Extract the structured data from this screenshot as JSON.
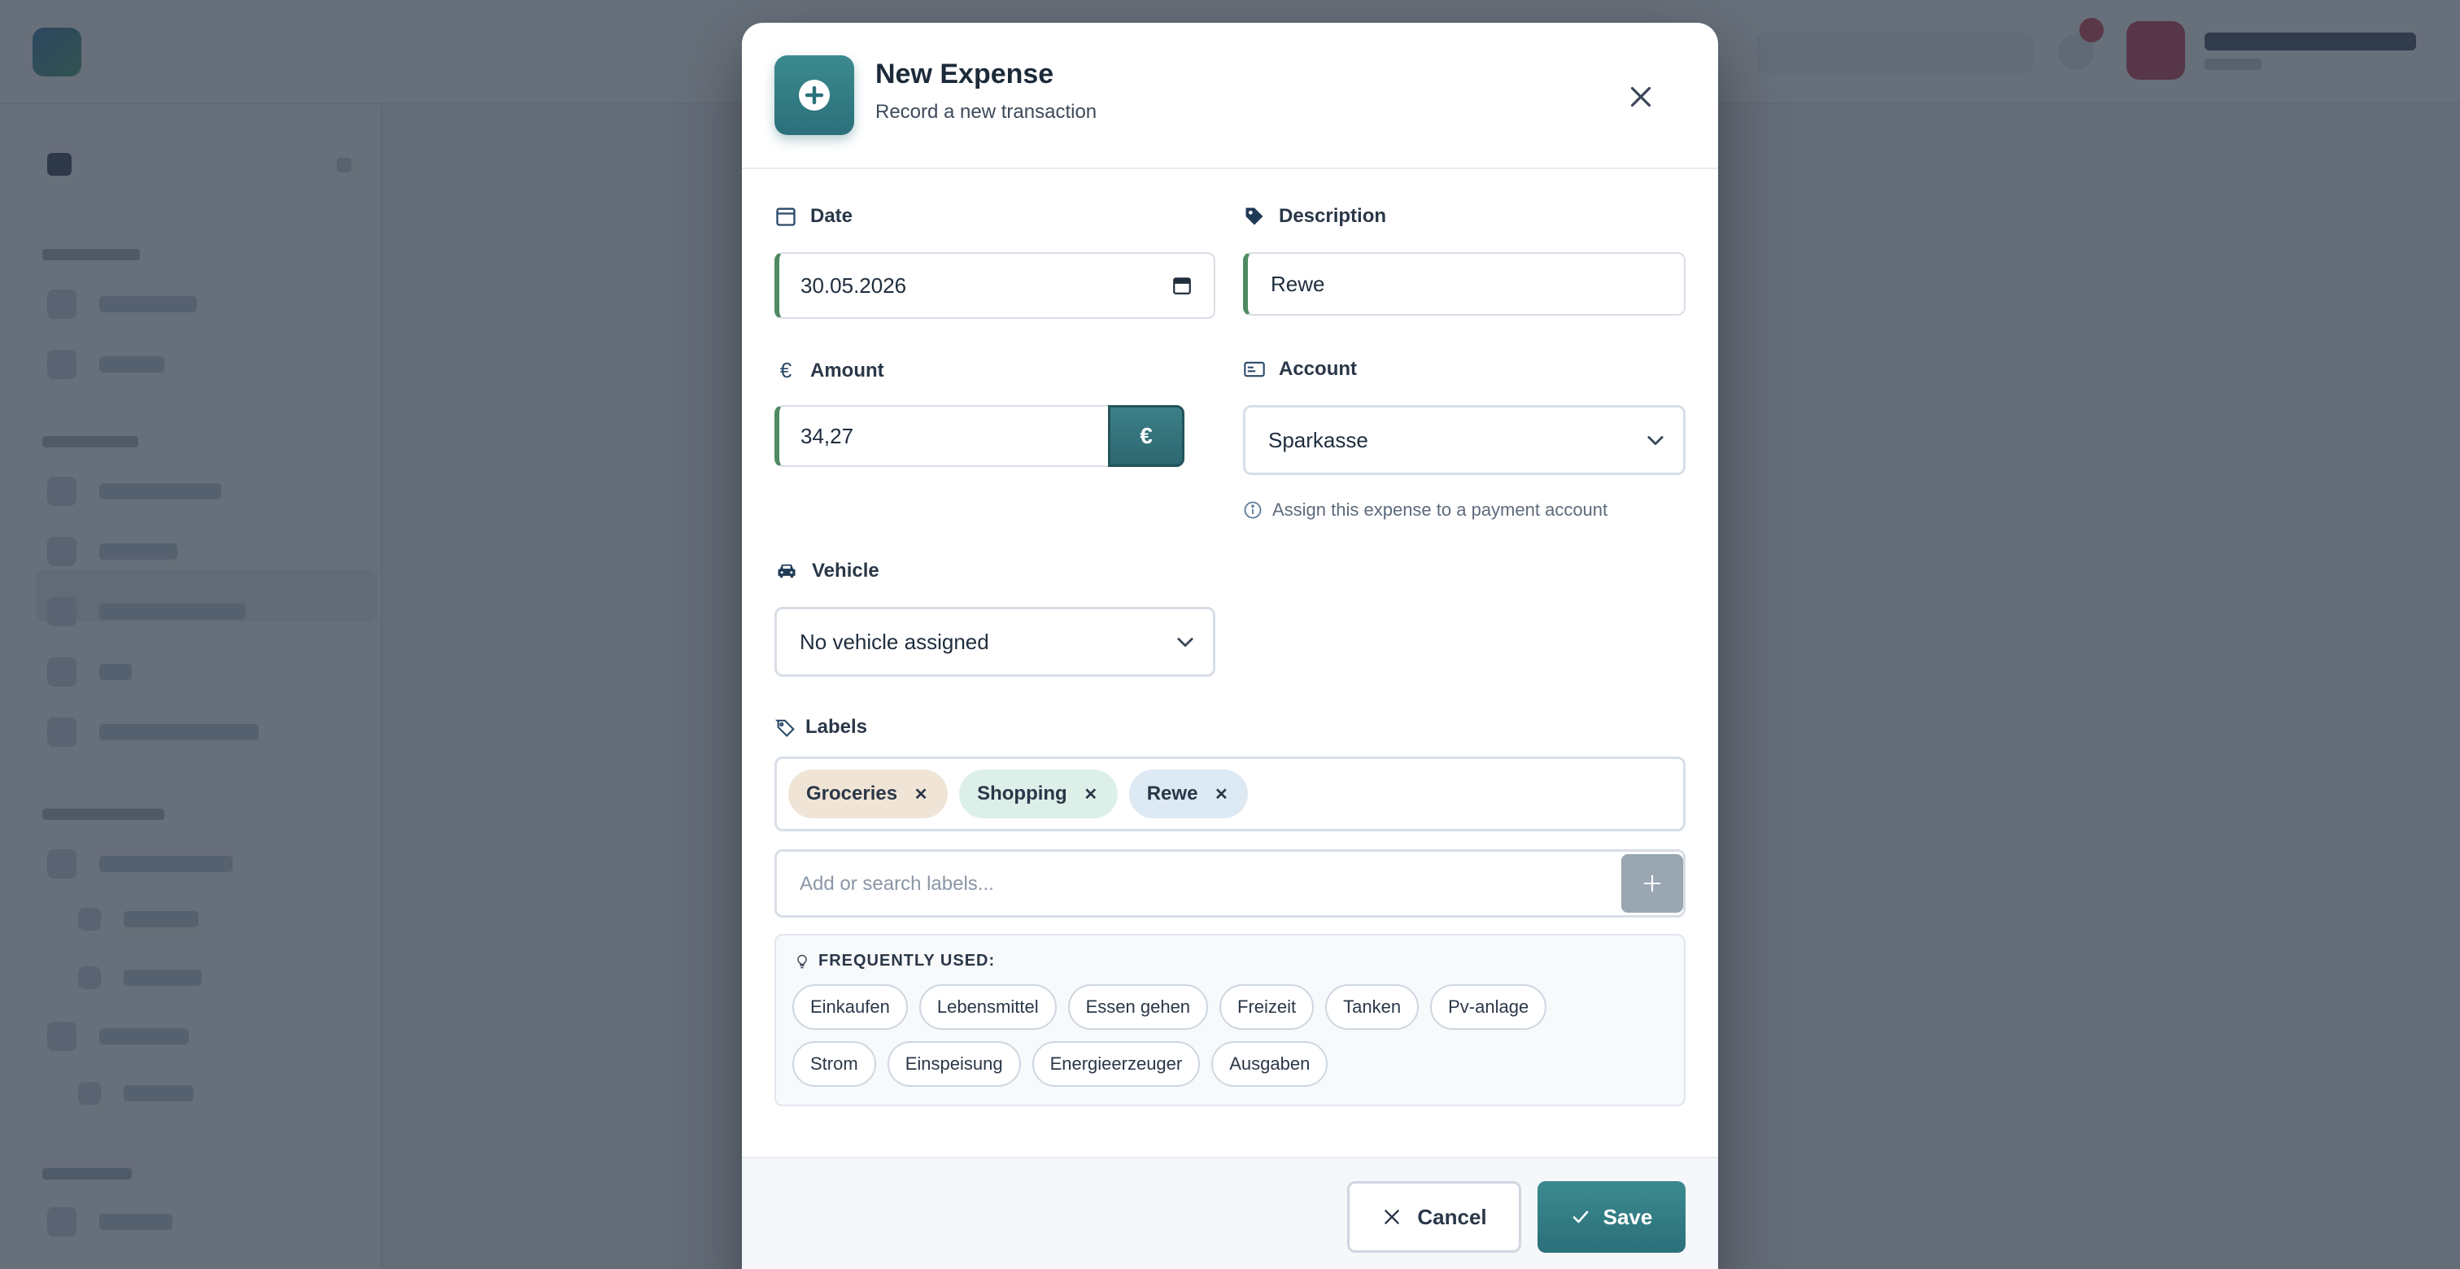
{
  "modal": {
    "title": "New Expense",
    "subtitle": "Record a new transaction"
  },
  "fields": {
    "date": {
      "label": "Date",
      "value": "30.05.2026"
    },
    "description": {
      "label": "Description",
      "value": "Rewe"
    },
    "amount": {
      "label": "Amount",
      "value": "34,27",
      "currency": "€"
    },
    "account": {
      "label": "Account",
      "value": "Sparkasse",
      "hint": "Assign this expense to a payment account"
    },
    "vehicle": {
      "label": "Vehicle",
      "value": "No vehicle assigned"
    }
  },
  "labels": {
    "label": "Labels",
    "selected": [
      {
        "text": "Groceries",
        "color": "#f0e4d6"
      },
      {
        "text": "Shopping",
        "color": "#dcefe9"
      },
      {
        "text": "Rewe",
        "color": "#dde9f3"
      }
    ],
    "search_placeholder": "Add or search labels...",
    "frequently_used_title": "FREQUENTLY USED:",
    "frequently_used": [
      "Einkaufen",
      "Lebensmittel",
      "Essen gehen",
      "Freizeit",
      "Tanken",
      "Pv-anlage",
      "Strom",
      "Einspeisung",
      "Energieerzeuger",
      "Ausgaben"
    ]
  },
  "footer": {
    "cancel_label": "Cancel",
    "save_label": "Save"
  },
  "colors": {
    "accent": "#2b6f7a",
    "field_accent": "#4f8a62",
    "overlay": "#2c3746"
  },
  "icons": {
    "header": "plus-circle-icon",
    "date": "calendar-icon",
    "description": "tag-icon",
    "amount": "euro-icon",
    "account": "credit-card-icon",
    "vehicle": "car-icon",
    "labels": "tags-icon",
    "hint": "info-icon",
    "frequent": "lightbulb-icon"
  }
}
